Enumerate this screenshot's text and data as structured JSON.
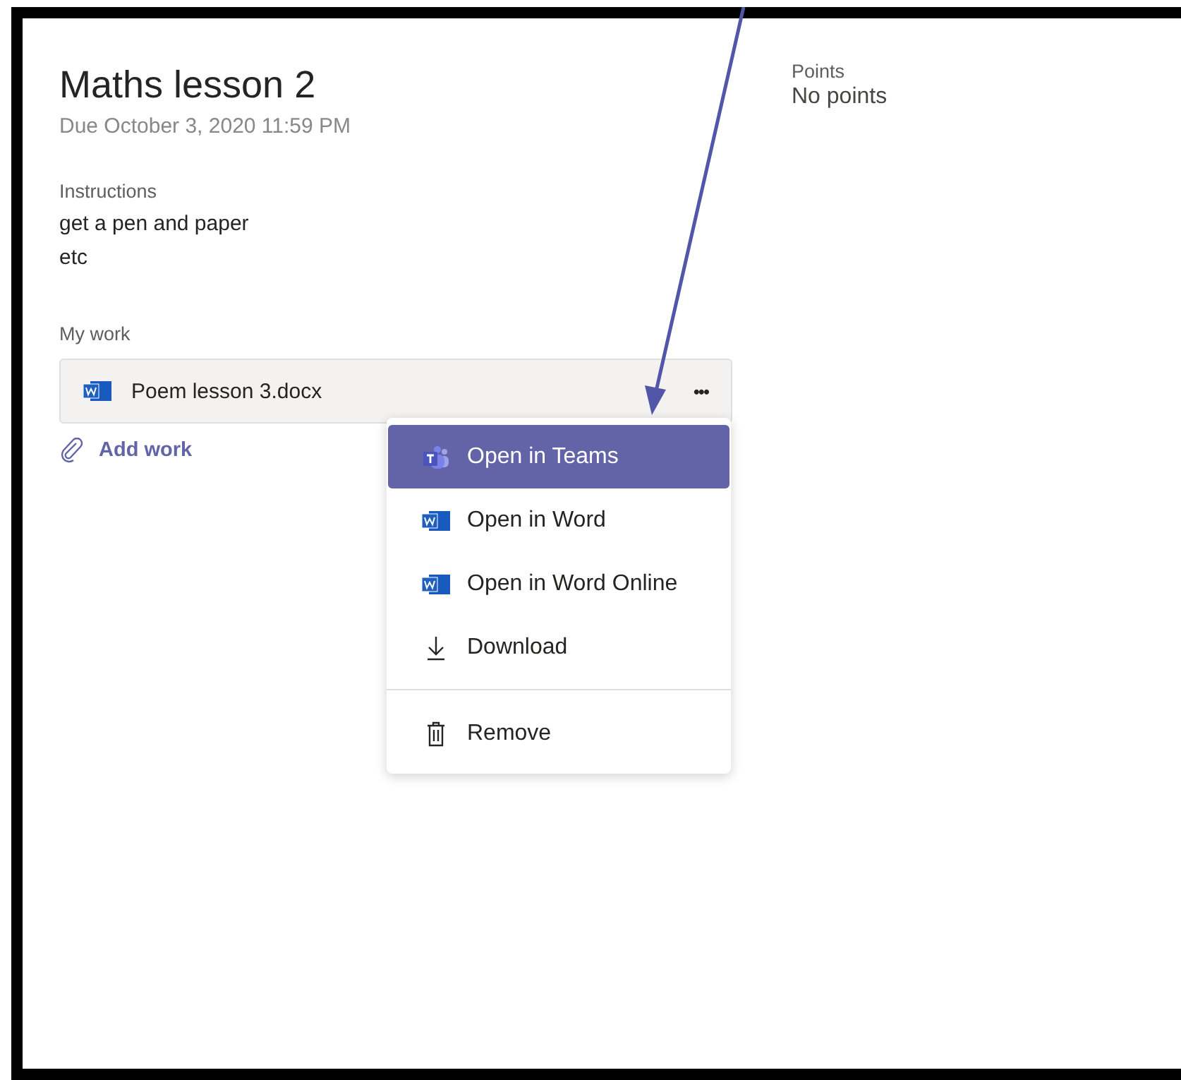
{
  "assignment": {
    "title": "Maths lesson 2",
    "due": "Due October 3, 2020 11:59 PM",
    "instructions_label": "Instructions",
    "instructions": [
      "get a pen and paper",
      "etc"
    ],
    "my_work_label": "My work",
    "file": {
      "name": "Poem lesson 3.docx",
      "more": "•••"
    },
    "add_work": "Add work"
  },
  "points": {
    "label": "Points",
    "value": "No points"
  },
  "menu": {
    "groups": [
      [
        {
          "label": "Open in Teams",
          "kind": "teams",
          "selected": true
        },
        {
          "label": "Open in Word",
          "kind": "word",
          "selected": false
        },
        {
          "label": "Open in Word Online",
          "kind": "word",
          "selected": false
        },
        {
          "label": "Download",
          "kind": "download",
          "selected": false
        }
      ],
      [
        {
          "label": "Remove",
          "kind": "remove",
          "selected": false
        }
      ]
    ]
  }
}
